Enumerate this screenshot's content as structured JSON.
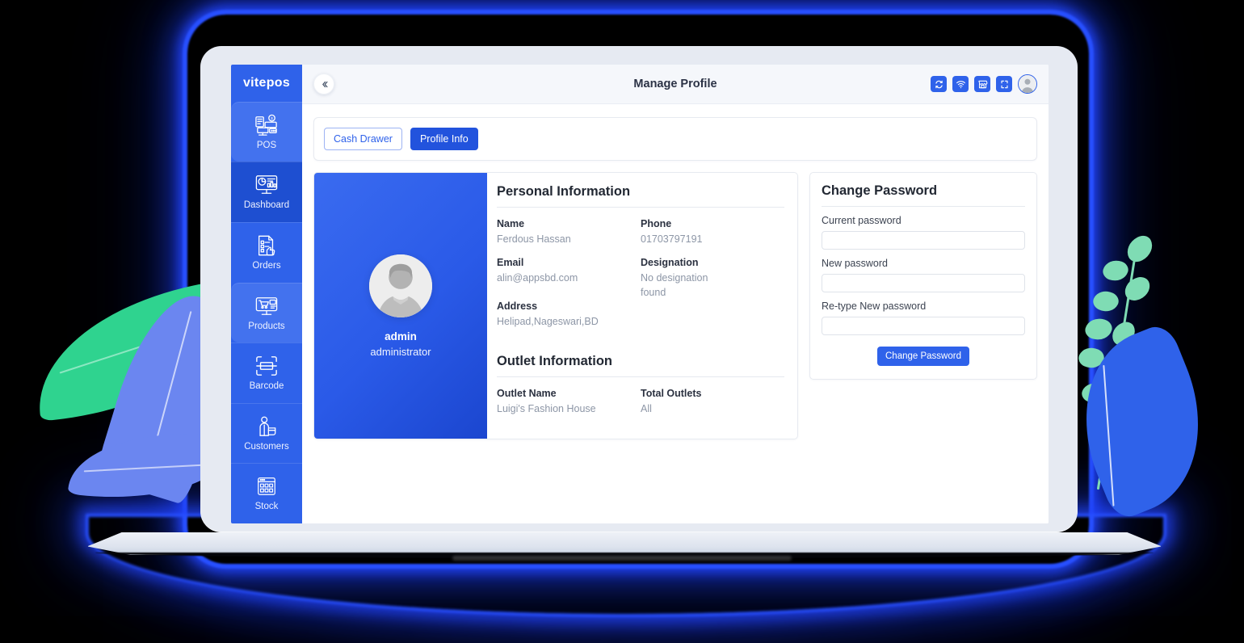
{
  "app": {
    "brand": "vitepos",
    "header_title": "Manage Profile",
    "collapse_icon": "chevron-double-left-icon"
  },
  "sidebar": {
    "items": [
      {
        "label": "POS",
        "icon": "pos-terminal-icon",
        "state": "hover"
      },
      {
        "label": "Dashboard",
        "icon": "dashboard-monitor-icon",
        "state": "active"
      },
      {
        "label": "Orders",
        "icon": "orders-checklist-icon",
        "state": "normal"
      },
      {
        "label": "Products",
        "icon": "products-monitor-icon",
        "state": "hover"
      },
      {
        "label": "Barcode",
        "icon": "barcode-scan-icon",
        "state": "normal"
      },
      {
        "label": "Customers",
        "icon": "customer-person-icon",
        "state": "normal"
      },
      {
        "label": "Stock",
        "icon": "stock-grid-icon",
        "state": "normal"
      }
    ]
  },
  "topbar": {
    "actions": [
      {
        "name": "sync-icon",
        "title": "Sync"
      },
      {
        "name": "wifi-icon",
        "title": "Network"
      },
      {
        "name": "store-icon",
        "title": "Outlet"
      },
      {
        "name": "fullscreen-icon",
        "title": "Fullscreen"
      }
    ],
    "avatar": "user-avatar"
  },
  "tabs": {
    "cash_drawer": "Cash Drawer",
    "profile_info": "Profile Info"
  },
  "profile": {
    "name": "admin",
    "role": "administrator",
    "personal_title": "Personal Information",
    "outlet_title": "Outlet Information",
    "fields": {
      "name_label": "Name",
      "name_value": "Ferdous Hassan",
      "phone_label": "Phone",
      "phone_value": "01703797191",
      "email_label": "Email",
      "email_value": "alin@appsbd.com",
      "designation_label": "Designation",
      "designation_value": "No designation found",
      "address_label": "Address",
      "address_value": "Helipad,Nageswari,BD",
      "outlet_name_label": "Outlet Name",
      "outlet_name_value": "Luigi's Fashion House",
      "total_outlets_label": "Total Outlets",
      "total_outlets_value": "All"
    }
  },
  "change_password": {
    "title": "Change Password",
    "current_label": "Current password",
    "current_value": "",
    "new_label": "New password",
    "new_value": "",
    "retype_label": "Re-type New password",
    "retype_value": "",
    "submit": "Change Password"
  },
  "colors": {
    "brand_blue": "#2f62ea",
    "active_blue": "#1e4fd1",
    "primary_btn": "#2253dd",
    "leaf_green": "#2fd38f",
    "leaf_mint": "#7fdcb4",
    "leaf_periwinkle": "#6b86f0",
    "bezel": "#e6eaf2",
    "topbar_bg": "#f5f7fb",
    "muted_text": "#8d96a6"
  }
}
